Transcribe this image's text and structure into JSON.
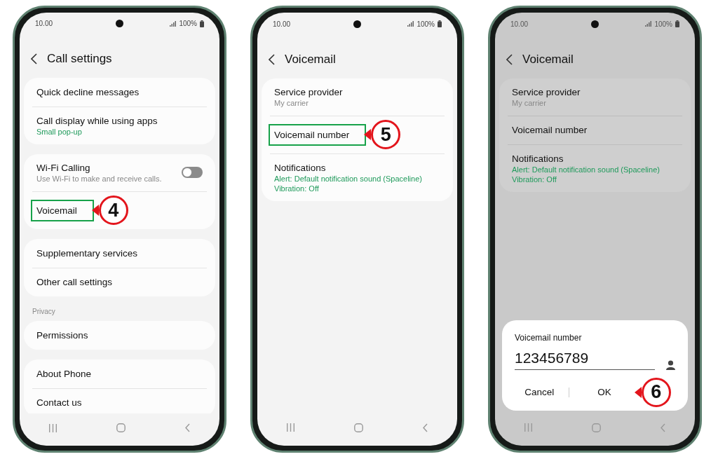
{
  "phones": [
    {
      "status": {
        "time": "10.00",
        "battery": "100%"
      },
      "title": "Call settings",
      "dimmed": false,
      "sections": [
        {
          "items": [
            {
              "title": "Quick decline messages"
            },
            {
              "title": "Call display while using apps",
              "subs": [
                "Small pop-up"
              ],
              "color": "#1f9a5b"
            }
          ]
        },
        {
          "items": [
            {
              "title": "Wi-Fi Calling",
              "subs": [
                "Use Wi-Fi to make and receive calls."
              ],
              "color": "#888888",
              "toggle": {
                "on": false
              }
            },
            {
              "title": "Voicemail",
              "callout": "4"
            }
          ]
        },
        {
          "items": [
            {
              "title": "Supplementary services"
            },
            {
              "title": "Other call settings"
            }
          ]
        },
        {
          "header": "Privacy",
          "items": [
            {
              "title": "Permissions"
            }
          ]
        },
        {
          "items": [
            {
              "title": "About Phone"
            },
            {
              "title": "Contact us"
            }
          ]
        }
      ]
    },
    {
      "status": {
        "time": "10.00",
        "battery": "100%"
      },
      "title": "Voicemail",
      "dimmed": false,
      "sections": [
        {
          "items": [
            {
              "title": "Service provider",
              "subs": [
                "My carrier"
              ],
              "color": "#888888"
            },
            {
              "title": "Voicemail number",
              "callout": "5"
            },
            {
              "title": "Notifications",
              "subs": [
                "Alert: Default notification sound (Spaceline)",
                "Vibration: Off"
              ],
              "color": "#1f9a5b"
            }
          ]
        }
      ]
    },
    {
      "status": {
        "time": "10.00",
        "battery": "100%"
      },
      "title": "Voicemail",
      "dimmed": true,
      "sections": [
        {
          "items": [
            {
              "title": "Service provider",
              "subs": [
                "My carrier"
              ],
              "color": "#888888"
            },
            {
              "title": "Voicemail number"
            },
            {
              "title": "Notifications",
              "subs": [
                "Alert: Default notification sound (Spaceline)",
                "Vibration: Off"
              ],
              "color": "#1f9a5b"
            }
          ]
        }
      ],
      "dialog": {
        "title": "Voicemail number",
        "value": "123456789",
        "buttons": [
          {
            "label": "Cancel"
          },
          {
            "label": "OK",
            "callout": "6"
          }
        ]
      }
    }
  ]
}
